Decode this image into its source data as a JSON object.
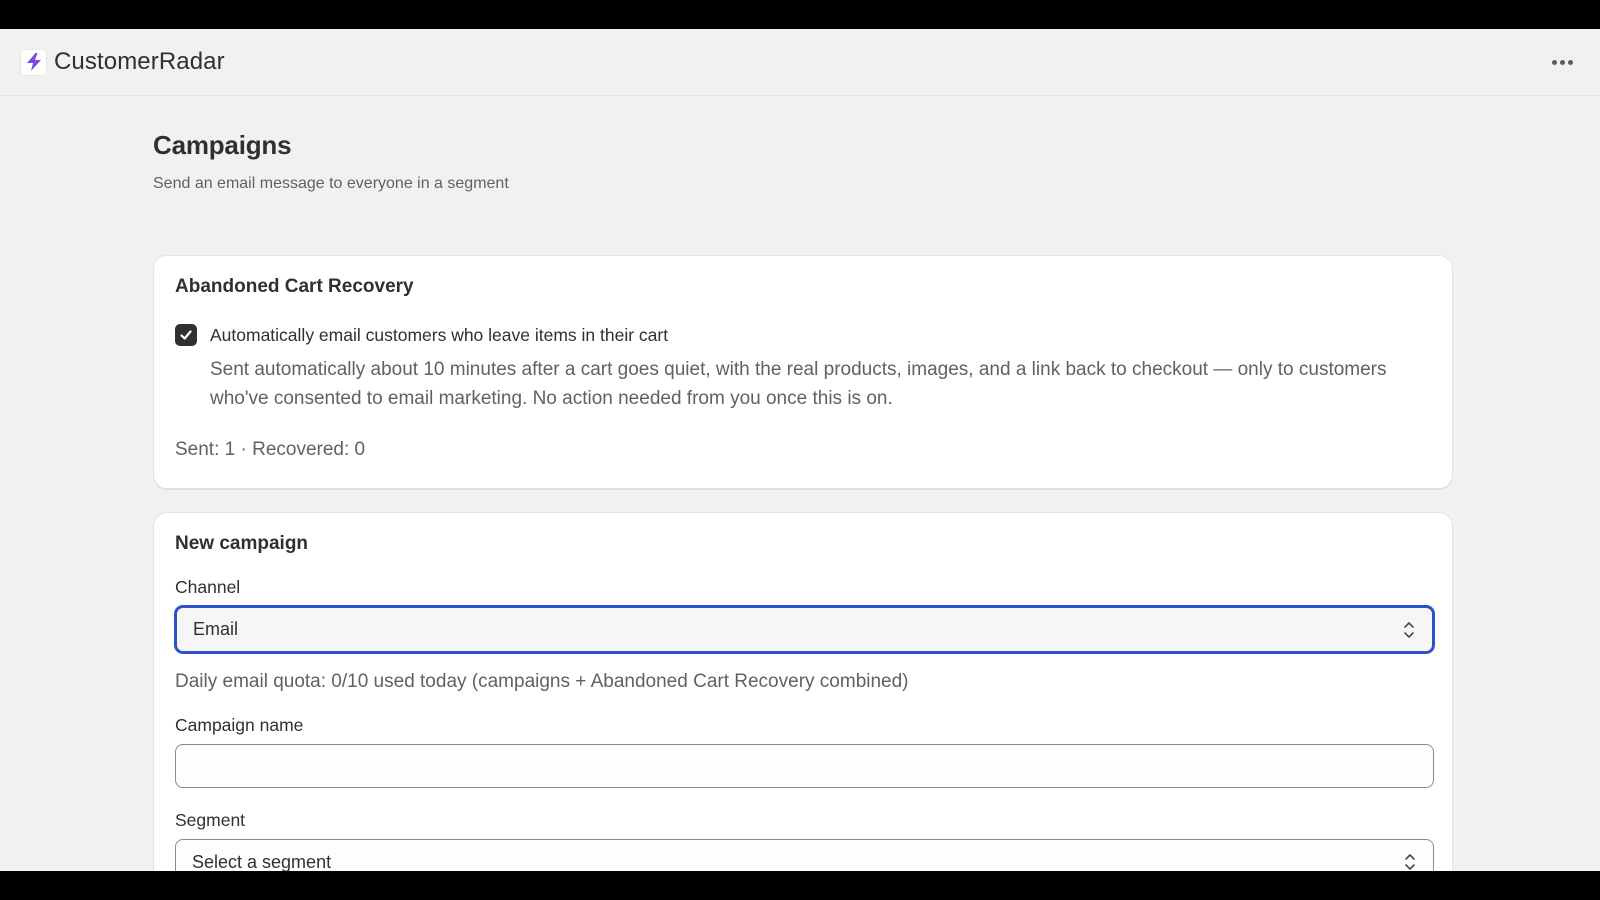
{
  "app": {
    "name": "CustomerRadar",
    "logo_icon": "lightning-bolt-icon",
    "brand_color": "#7b4bdc"
  },
  "header": {
    "more_icon": "more-horizontal-icon"
  },
  "page": {
    "title": "Campaigns",
    "subtitle": "Send an email message to everyone in a segment"
  },
  "abandoned_cart": {
    "title": "Abandoned Cart Recovery",
    "checkbox_checked": true,
    "checkbox_label": "Automatically email customers who leave items in their cart",
    "help_text": "Sent automatically about 10 minutes after a cart goes quiet, with the real products, images, and a link back to checkout — only to customers who've consented to email marketing. No action needed from you once this is on.",
    "stats": "Sent: 1 · Recovered: 0"
  },
  "new_campaign": {
    "title": "New campaign",
    "channel_label": "Channel",
    "channel_value": "Email",
    "quota_text": "Daily email quota: 0/10 used today (campaigns + Abandoned Cart Recovery combined)",
    "name_label": "Campaign name",
    "name_value": "",
    "segment_label": "Segment",
    "segment_value": "Select a segment"
  },
  "colors": {
    "focus_ring": "#2d52c7",
    "checkbox_fill": "#303030",
    "page_bg": "#f1f1f1"
  }
}
